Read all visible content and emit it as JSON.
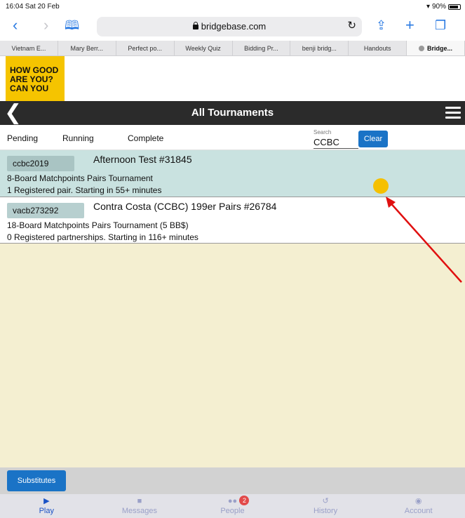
{
  "status_bar": {
    "time_date": "16:04  Sat 20 Feb",
    "battery": "90%"
  },
  "browser": {
    "url": "bridgebase.com",
    "tabs": [
      {
        "label": "Vietnam E..."
      },
      {
        "label": "Mary Berr..."
      },
      {
        "label": "Perfect po..."
      },
      {
        "label": "Weekly Quiz"
      },
      {
        "label": "Bidding Pr..."
      },
      {
        "label": "benji bridg..."
      },
      {
        "label": "Handouts"
      },
      {
        "label": "Bridge..."
      }
    ]
  },
  "ad": {
    "text": "HOW GOOD ARE YOU? CAN YOU"
  },
  "header": {
    "title": "All Tournaments"
  },
  "filters": {
    "tabs": [
      {
        "label": "Pending"
      },
      {
        "label": "Running"
      },
      {
        "label": "Complete"
      }
    ],
    "search_label": "Search",
    "search_value": "CCBC",
    "clear_label": "Clear"
  },
  "tournaments": [
    {
      "host": "ccbc2019",
      "title": "Afternoon Test #31845",
      "description": "8-Board Matchpoints Pairs Tournament",
      "status": "1 Registered pair. Starting in 55+ minutes"
    },
    {
      "host": "vacb273292",
      "title": "Contra Costa (CCBC) 199er Pairs #26784",
      "description": "18-Board Matchpoints Pairs Tournament (5 BB$)",
      "status": "0 Registered partnerships. Starting in 116+ minutes"
    }
  ],
  "substitutes_label": "Substitutes",
  "nav": {
    "items": [
      {
        "label": "Play",
        "icon": "play-icon"
      },
      {
        "label": "Messages",
        "icon": "message-icon"
      },
      {
        "label": "People",
        "icon": "people-icon",
        "badge": "2"
      },
      {
        "label": "History",
        "icon": "history-icon"
      },
      {
        "label": "Account",
        "icon": "account-icon"
      }
    ]
  },
  "colors": {
    "header_bg": "#2b2b2b",
    "selected_row": "#c9e2e0",
    "list_bg": "#f4efd1",
    "accent_blue": "#1a73c6",
    "status_dot": "#f5c000",
    "arrow": "#e01010"
  }
}
